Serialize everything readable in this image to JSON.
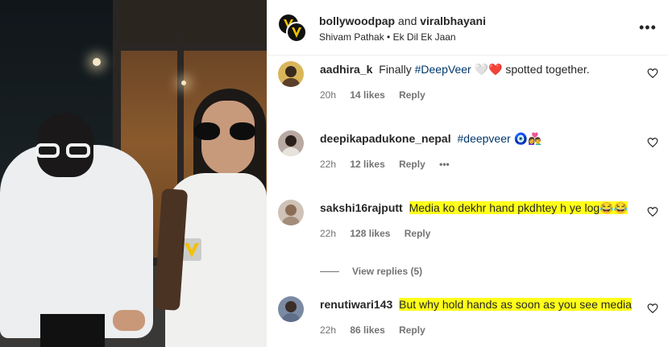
{
  "post": {
    "owner": "bollywoodpap",
    "connector": "and",
    "collaborator": "viralbhayani",
    "audio": "Shivam Pathak • Ek Dil Ek Jaan",
    "more_icon": "more-horizontal-icon"
  },
  "comments": [
    {
      "username": "aadhira_k",
      "text_before": "Finally ",
      "hashtag": "#DeepVeer",
      "emoji": "🤍❤️",
      "text_after": " spotted together.",
      "time": "20h",
      "likes": "14 likes",
      "reply": "Reply",
      "avatar_color": "#d9b65a"
    },
    {
      "username": "deepikapadukone_nepal",
      "hashtag": "#deepveer",
      "emoji": "🧿👩‍❤️‍👨",
      "time": "22h",
      "likes": "12 likes",
      "reply": "Reply",
      "options": "•••",
      "avatar_color": "#b8a9a2"
    },
    {
      "username": "sakshi16rajputt",
      "text": "Media ko dekhr hand pkdhtey h ye log",
      "emoji": "😂😂",
      "time": "22h",
      "likes": "128 likes",
      "reply": "Reply",
      "avatar_color": "#cfc2b6"
    },
    {
      "username": "renutiwari143",
      "text": "But why hold hands as soon as you see media",
      "time": "22h",
      "likes": "86 likes",
      "reply": "Reply",
      "avatar_color": "#7b8aa3"
    }
  ],
  "view_replies": "View replies (5)",
  "colors": {
    "highlight": "#ffff1a",
    "hashtag": "#00376b",
    "meta": "#737373",
    "text": "#262626",
    "heart_red": "#ed1c24"
  }
}
